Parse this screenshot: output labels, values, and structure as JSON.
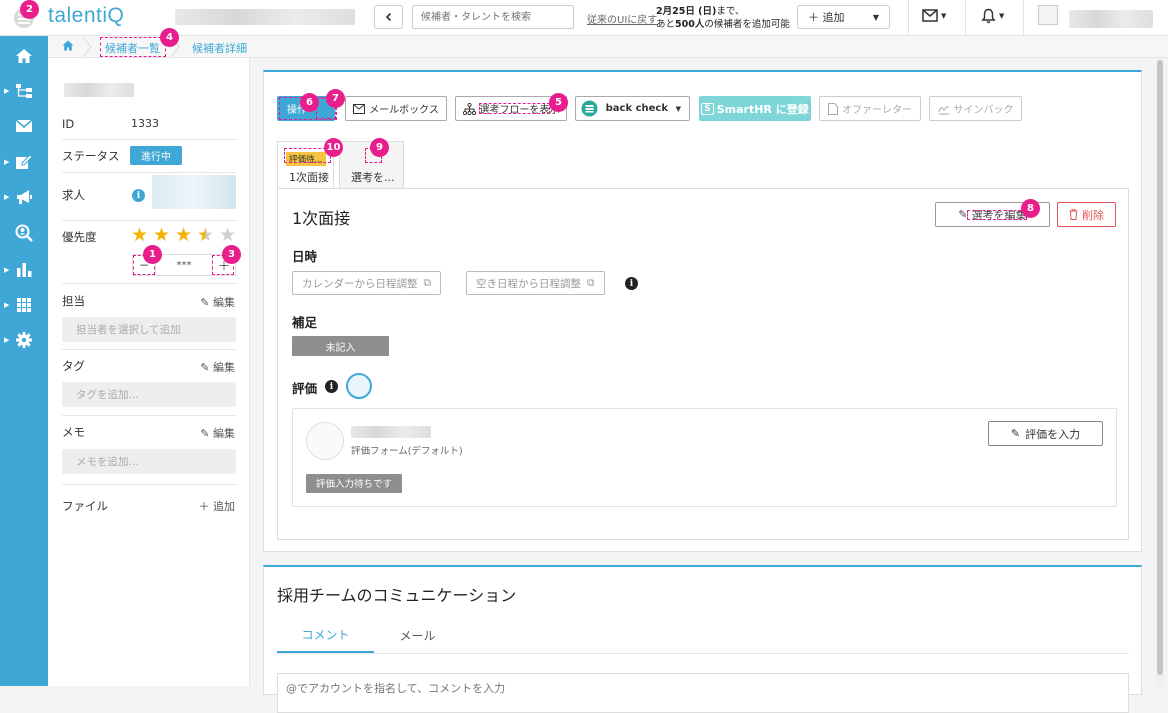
{
  "header": {
    "logo_text": "talentiQ",
    "search_placeholder": "候補者・タレントを検索",
    "old_ui_link": "従来のUIに戻す",
    "notice_line1_date": "2月25日 (日)",
    "notice_line1_suffix": "まで、",
    "notice_line2_prefix": "あと",
    "notice_line2_count": "500人",
    "notice_line2_suffix": "の候補者を追加可能",
    "add_button": "＋ 追加",
    "mail_icon_label": "mail-icon",
    "bell_icon_label": "bell-icon"
  },
  "breadcrumb": {
    "items": [
      "候補者一覧",
      "候補者詳細"
    ]
  },
  "left_panel": {
    "id_label": "ID",
    "id_value": "1333",
    "status_label": "ステータス",
    "status_value": "進行中",
    "job_label": "求人",
    "priority_label": "優先度",
    "priority_rating": 3.5,
    "priority_max": 5,
    "stepper_minus": "−",
    "stepper_value": "***",
    "stepper_plus": "＋",
    "assignee_label": "担当",
    "assignee_edit": "編集",
    "assignee_placeholder": "担当者を選択して追加",
    "tag_label": "タグ",
    "tag_edit": "編集",
    "tag_placeholder": "タグを追加...",
    "memo_label": "メモ",
    "memo_edit": "編集",
    "memo_placeholder": "メモを追加...",
    "file_label": "ファイル",
    "file_add": "追加"
  },
  "toolbar": {
    "primary_button": "操作",
    "mailbox_button": "メールボックス",
    "flow_button": "選考フローを表示",
    "backcheck_button": "back check",
    "smarthr_button": "SmartHR に登録",
    "offer_button": "オファーレター",
    "signback_button": "サインバック"
  },
  "stage_tabs": [
    {
      "badge": "評価待...",
      "label": "1次面接"
    },
    {
      "badge": "",
      "label": "選考を..."
    }
  ],
  "stage_panel": {
    "title": "1次面接",
    "edit_button": "選考を編集",
    "delete_button": "削除",
    "datetime_label": "日時",
    "calendar_button": "カレンダーから日程調整",
    "free_slot_button": "空き日程から日程調整",
    "note_label": "補足",
    "note_value": "未記入",
    "eval_label": "評価",
    "eval_form_name": "評価フォーム(デフォルト)",
    "eval_input_button": "評価を入力",
    "eval_status": "評価入力待ちです"
  },
  "communication": {
    "title": "採用チームのコミュニケーション",
    "tabs": [
      "コメント",
      "メール"
    ],
    "comment_placeholder": "@でアカウントを指名して、コメントを入力"
  },
  "annotations": [
    "1",
    "2",
    "3",
    "4",
    "5",
    "6",
    "7",
    "8",
    "9",
    "10"
  ],
  "colors": {
    "brand": "#3fa7d6",
    "annotation": "#e91e8c",
    "star_filled": "#f5b301",
    "smarthr": "#7fd6d9"
  }
}
